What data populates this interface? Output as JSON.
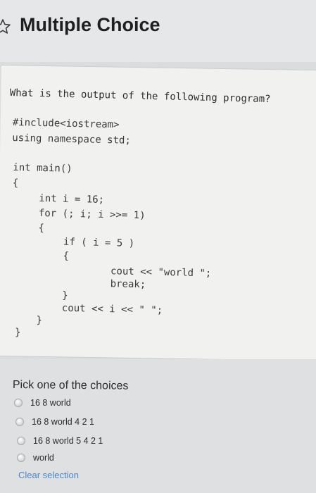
{
  "header": {
    "title": "Multiple Choice",
    "icon": "star-icon"
  },
  "question": {
    "text": "What is the output of the following program?",
    "code_lines": [
      "#include<iostream>",
      "using namespace std;",
      "int main()",
      "{",
      "int i = 16;",
      "for (; i; i >>= 1)",
      "{",
      "if ( i = 5 )",
      "{",
      "cout << \"world \";",
      "break;",
      "}",
      "cout << i << \" \";",
      "}",
      "}"
    ]
  },
  "choices": {
    "heading": "Pick one of the choices",
    "options": [
      {
        "label": "16 8 world"
      },
      {
        "label": "16 8 world 4 2 1"
      },
      {
        "label": "16 8 world 5 4 2 1"
      },
      {
        "label": "world"
      }
    ],
    "clear_label": "Clear selection"
  },
  "colors": {
    "header_background": "#e6e7e8",
    "panel_background": "#f1f1f0",
    "link": "#4f86c6"
  }
}
